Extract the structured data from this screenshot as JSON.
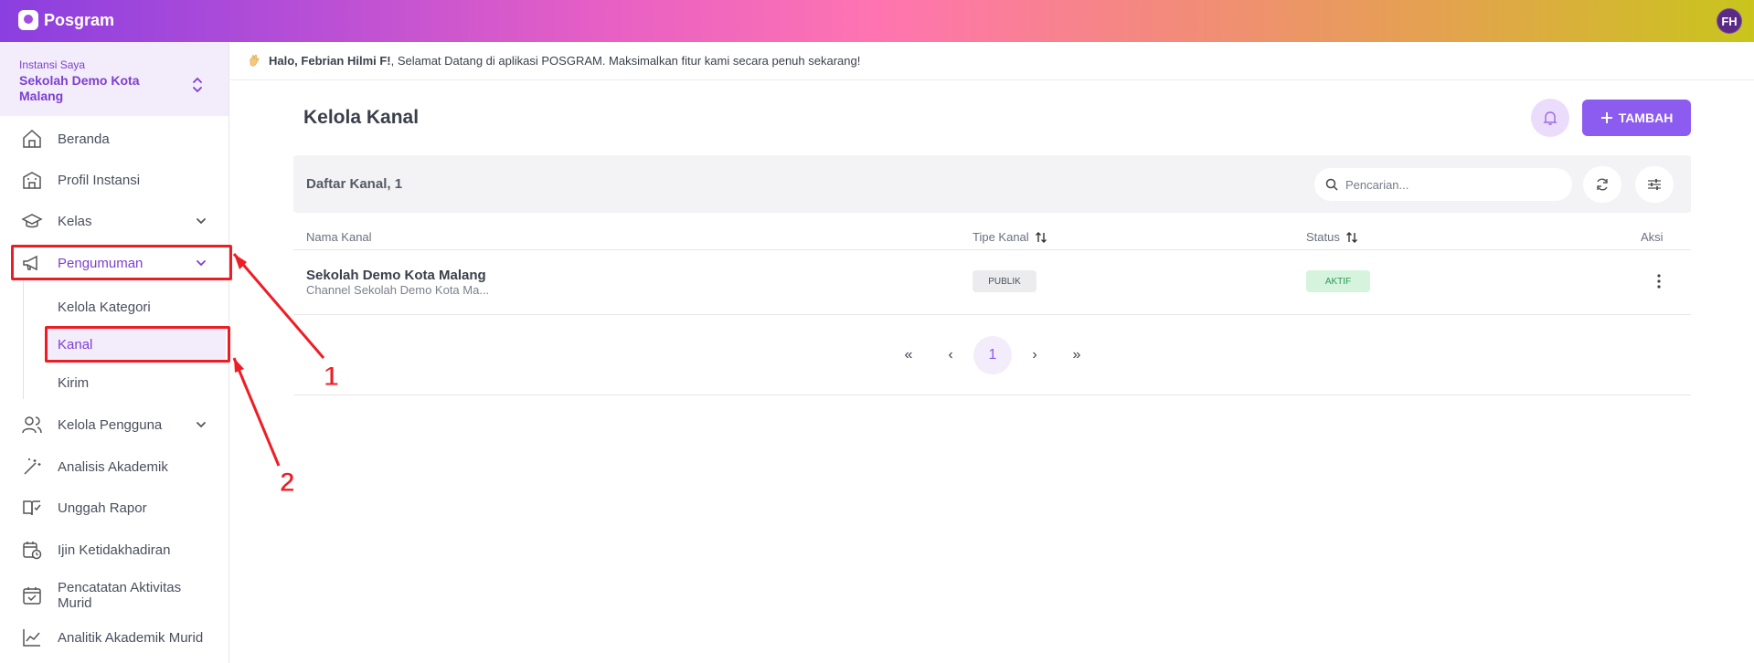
{
  "app": {
    "brand": "Posgram",
    "user_initials": "FH"
  },
  "institution": {
    "caption": "Instansi Saya",
    "name": "Sekolah Demo Kota Malang"
  },
  "sidebar": {
    "items": [
      {
        "label": "Beranda",
        "icon": "home-icon"
      },
      {
        "label": "Profil Instansi",
        "icon": "building-icon"
      },
      {
        "label": "Kelas",
        "icon": "graduation-cap-icon"
      },
      {
        "label": "Pengumuman",
        "icon": "megaphone-icon"
      },
      {
        "label": "Kelola Pengguna",
        "icon": "users-icon"
      },
      {
        "label": "Analisis Akademik",
        "icon": "magic-wand-icon"
      },
      {
        "label": "Unggah Rapor",
        "icon": "book-check-icon"
      },
      {
        "label": "Ijin Ketidakhadiran",
        "icon": "calendar-clock-icon"
      },
      {
        "label": "Pencatatan Aktivitas Murid",
        "icon": "calendar-check-icon"
      },
      {
        "label": "Analitik Akademik Murid",
        "icon": "line-chart-icon"
      }
    ],
    "sub_items": [
      {
        "label": "Kelola Kategori"
      },
      {
        "label": "Kanal"
      },
      {
        "label": "Kirim"
      }
    ]
  },
  "welcome": {
    "greeting": "Halo, Febrian Hilmi F!",
    "message": ", Selamat Datang di aplikasi POSGRAM. Maksimalkan fitur kami secara penuh sekarang!"
  },
  "page": {
    "title": "Kelola Kanal",
    "add_label": "TAMBAH"
  },
  "table": {
    "title": "Daftar Kanal, 1",
    "search_placeholder": "Pencarian...",
    "columns": [
      "Nama Kanal",
      "Tipe Kanal",
      "Status",
      "Aksi"
    ],
    "rows": [
      {
        "name": "Sekolah Demo Kota Malang",
        "desc": "Channel Sekolah Demo Kota Ma...",
        "type": "PUBLIK",
        "status": "AKTIF"
      }
    ]
  },
  "pagination": {
    "first": "«",
    "prev": "‹",
    "current": "1",
    "next": "›",
    "last": "»"
  },
  "annotations": {
    "label_1": "1",
    "label_2": "2",
    "color": "#ee1d24"
  },
  "colors": {
    "accent": "#8c5bf0",
    "accent_text": "#7d3fd0",
    "active_bg": "#f3ecfb",
    "status_active": "#2c9a52"
  }
}
